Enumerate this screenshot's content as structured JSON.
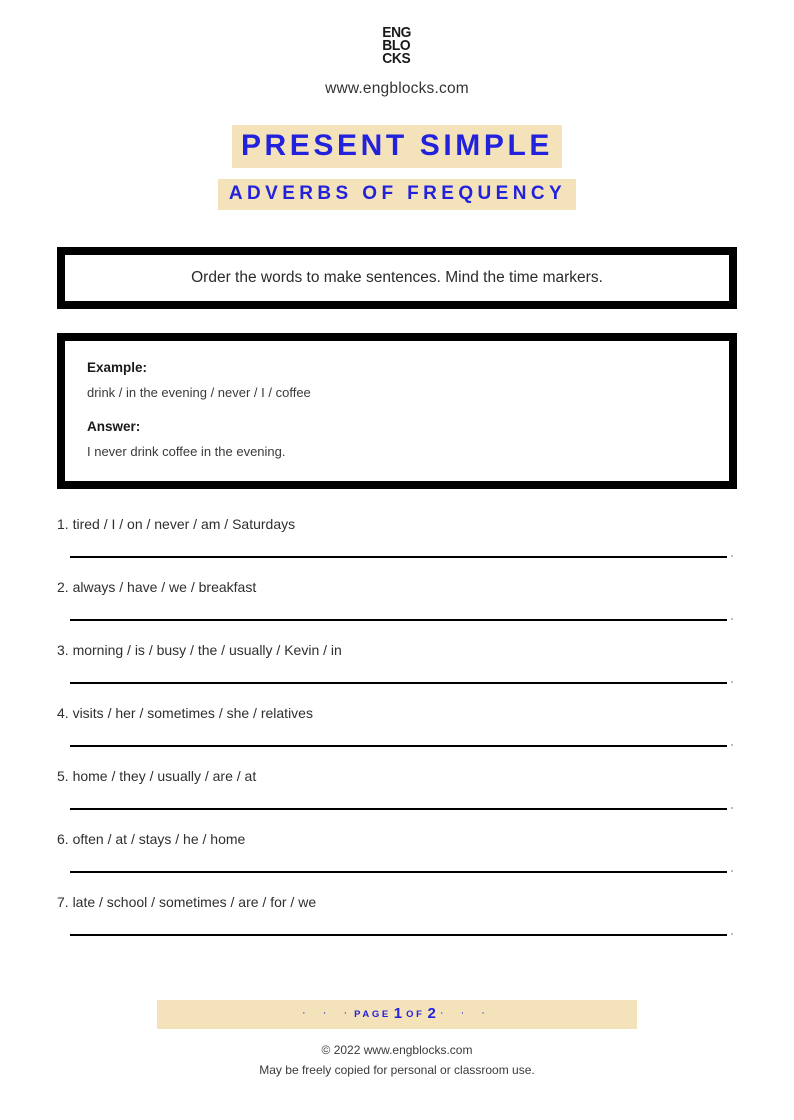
{
  "brand": {
    "logo_line1": "ENG",
    "logo_line2": "BLO",
    "logo_line3": "CKS",
    "site_url": "www.engblocks.com"
  },
  "title": {
    "main": "PRESENT SIMPLE",
    "sub": "ADVERBS OF FREQUENCY",
    "highlight_color": "#f4e2ba",
    "text_color": "#2222dd"
  },
  "instruction": {
    "text": "Order the words to make sentences. Mind the time markers."
  },
  "example": {
    "example_label": "Example:",
    "example_prompt": "drink / in the evening / never / I / coffee",
    "answer_label": "Answer:",
    "answer_text": "I never drink coffee in the evening."
  },
  "exercises": [
    {
      "text": "1. tired / I / on / never / am / Saturdays"
    },
    {
      "text": "2. always / have / we / breakfast"
    },
    {
      "text": "3. morning / is / busy / the / usually / Kevin / in"
    },
    {
      "text": "4. visits / her / sometimes / she / relatives"
    },
    {
      "text": "5. home / they / usually / are / at"
    },
    {
      "text": "6. often / at / stays / he / home"
    },
    {
      "text": "7. late / school / sometimes / are / for / we"
    }
  ],
  "footer": {
    "dots_left": "· · ·",
    "page_word": "PAGE",
    "page_current": "1",
    "of_word": "OF",
    "page_total": "2",
    "dots_right": "· · ·",
    "copyright": "© 2022 www.engblocks.com",
    "license": "May be freely copied for personal or classroom use."
  }
}
